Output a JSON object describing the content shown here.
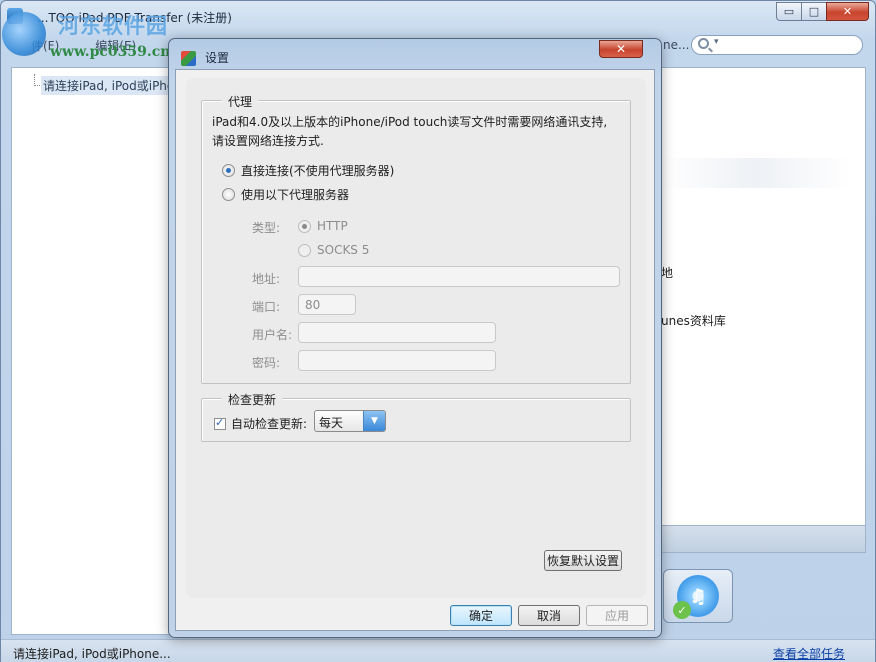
{
  "window": {
    "title": "...TOO iPad PDF Transfer (未注册)",
    "minimize": "▭",
    "maximize": "□",
    "close": "✕"
  },
  "watermark": {
    "line1": "河东软件园",
    "line2": "www.pc0359.cn"
  },
  "menubar": {
    "items": [
      "件(F)",
      "编辑(E)"
    ],
    "tail_text": "ne..."
  },
  "search": {
    "caret": "▾"
  },
  "tree": {
    "item": "请连接iPad, iPod或iPho..."
  },
  "right_panel": {
    "fragment1": "地",
    "fragment2": "unes资料库"
  },
  "itunes_button": {
    "glyph": "♫",
    "check": "✓"
  },
  "statusbar": {
    "text": "请连接iPad, iPod或iPhone...",
    "link": "查看全部任务"
  },
  "dialog": {
    "title": "设置",
    "close": "✕",
    "proxy": {
      "group_title": "代理",
      "description": "iPad和4.0及以上版本的iPhone/iPod touch读写文件时需要网络通讯支持, 请设置网络连接方式.",
      "option_direct": "直接连接(不使用代理服务器)",
      "option_proxy": "使用以下代理服务器",
      "selected": "direct",
      "type_label": "类型:",
      "type_http": "HTTP",
      "type_socks": "SOCKS 5",
      "address_label": "地址:",
      "address_value": "",
      "port_label": "端口:",
      "port_value": "80",
      "username_label": "用户名:",
      "username_value": "",
      "password_label": "密码:",
      "password_value": ""
    },
    "update": {
      "group_title": "检查更新",
      "auto_check_label": "自动检查更新:",
      "auto_check_checked": true,
      "frequency": "每天",
      "frequency_arrow": "▼"
    },
    "restore_defaults": "恢复默认设置",
    "ok": "确定",
    "cancel": "取消",
    "apply": "应用"
  },
  "colors": {
    "accent": "#2c6fbf",
    "window_frame": "#bdd2e9",
    "close_red": "#c7442d",
    "link": "#0a3fa6"
  }
}
